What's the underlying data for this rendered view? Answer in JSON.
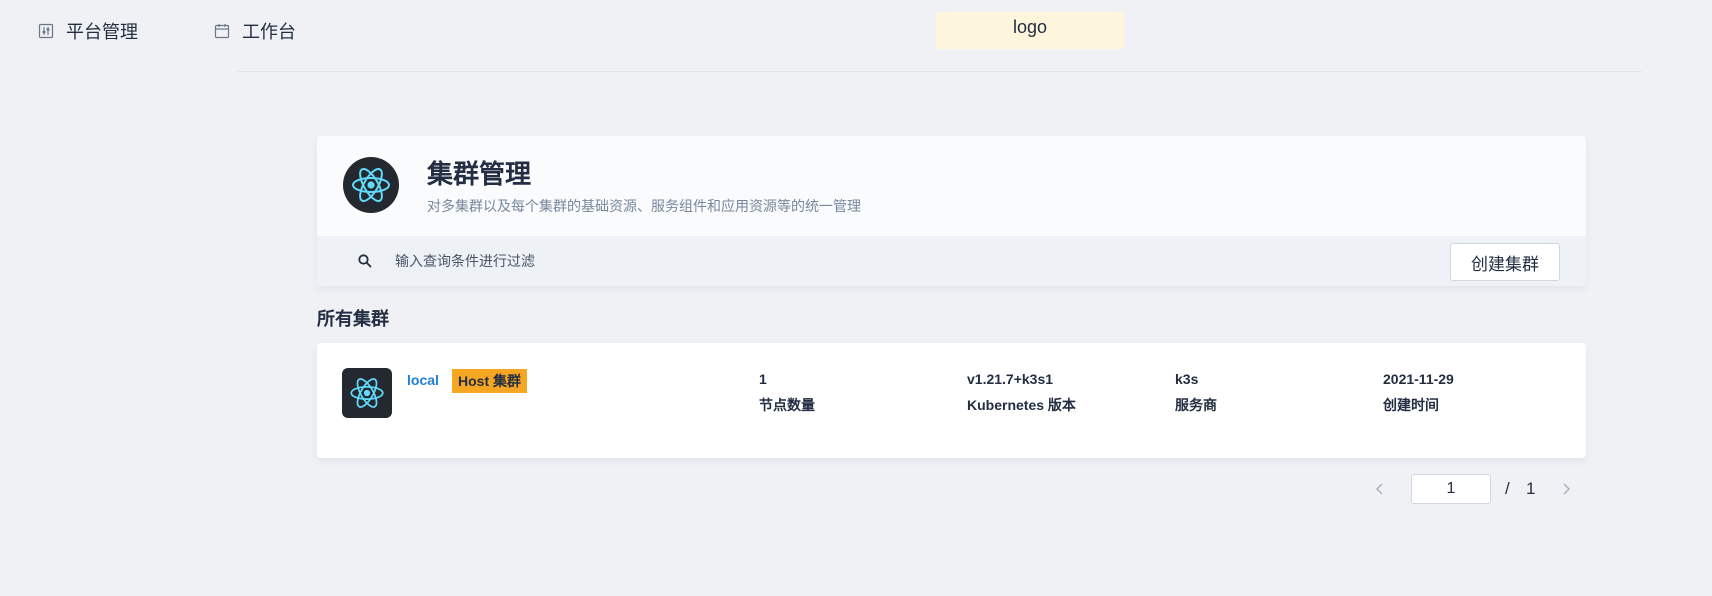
{
  "nav": {
    "platform_label": "平台管理",
    "platform_icon": "sliders-icon",
    "workbench_label": "工作台",
    "workbench_icon": "calendar-icon",
    "logo_text": "logo"
  },
  "banner": {
    "title": "集群管理",
    "description": "对多集群以及每个集群的基础资源、服务组件和应用资源等的统一管理",
    "icon": "react-atom-icon"
  },
  "toolbar": {
    "search_placeholder": "输入查询条件进行过滤",
    "create_label": "创建集群"
  },
  "section": {
    "title": "所有集群"
  },
  "clusters": [
    {
      "name": "local",
      "badge": "Host 集群",
      "icon": "react-atom-icon",
      "nodes": "1",
      "nodes_label": "节点数量",
      "version": "v1.21.7+k3s1",
      "version_label": "Kubernetes 版本",
      "provider": "k3s",
      "provider_label": "服务商",
      "created": "2021-11-29",
      "created_label": "创建时间"
    }
  ],
  "pagination": {
    "current": "1",
    "separator": "/",
    "total": "1"
  },
  "colors": {
    "background": "#eff1f5",
    "link": "#1f7ed9",
    "badge": "#f5a623",
    "logo_bg": "#fdf6dc",
    "atom": "#61dafb"
  }
}
